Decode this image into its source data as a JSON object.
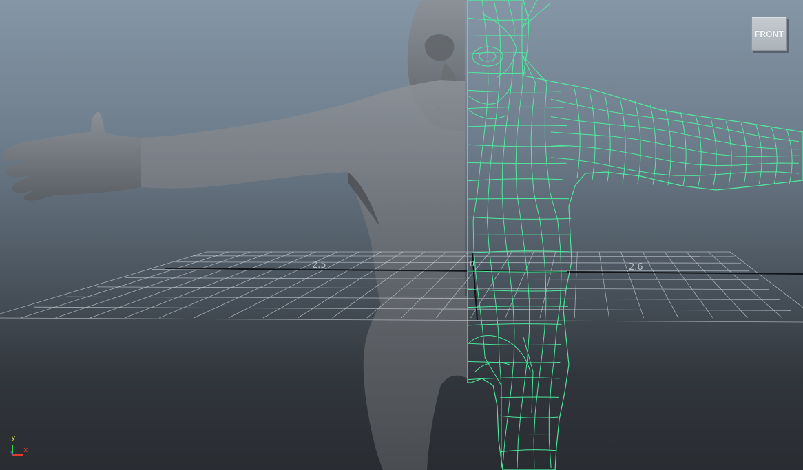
{
  "viewport": {
    "camera_label": "FRONT",
    "grid_labels": [
      "2.5",
      "0",
      "2.6"
    ],
    "colors": {
      "wireframe": "#4ef0a0",
      "mesh": "#777c82",
      "grid": "#c6cdd4"
    }
  },
  "axis": {
    "y_label": "y",
    "x_label": "x"
  }
}
